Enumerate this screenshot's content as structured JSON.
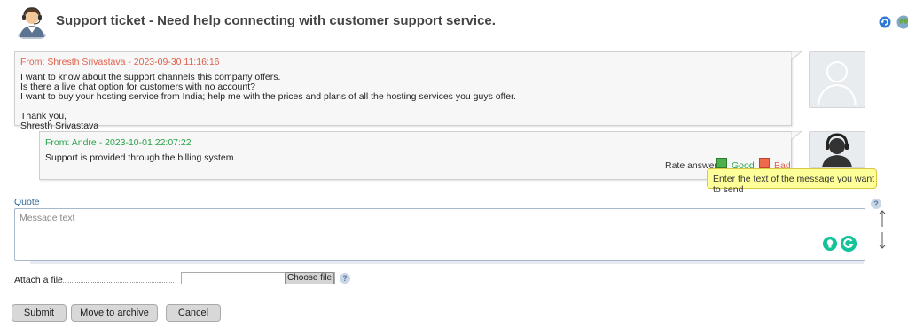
{
  "header": {
    "title": "Support ticket - Need help connecting with customer support service.",
    "icon": "support-agent-icon"
  },
  "toolbar": {
    "refresh_icon": "refresh-icon",
    "globe_icon": "globe-icon"
  },
  "messages": [
    {
      "from": "From: Shresth Srivastava - 2023-09-30 11:16:16",
      "body": "I want to know about the support channels this company offers.\nIs there a live chat option for customers with no account?\nI want to buy your hosting service from India; help me with the prices and plans of all the hosting services you guys offer.\n\nThank you,\nShresth Srivastava",
      "avatar": "user-silhouette-icon"
    },
    {
      "from": "From: Andre - 2023-10-01 22:07:22",
      "body": "Support is provided through the billing system.",
      "avatar": "support-headset-icon",
      "rate_label": "Rate answer",
      "rate_good": "Good",
      "rate_bad": "Bad"
    }
  ],
  "tooltip": "Enter the text of the message you want to send",
  "compose": {
    "quote_label": "Quote",
    "placeholder": "Message text",
    "help": "?"
  },
  "attach": {
    "label": "Attach a file",
    "choose_file": "Choose file",
    "help": "?"
  },
  "buttons": {
    "submit": "Submit",
    "archive": "Move to archive",
    "cancel": "Cancel"
  },
  "colors": {
    "client_from": "#e0604a",
    "staff_from": "#2aa24a",
    "tooltip_bg": "#ffff99",
    "grammarly": "#15c39a"
  }
}
